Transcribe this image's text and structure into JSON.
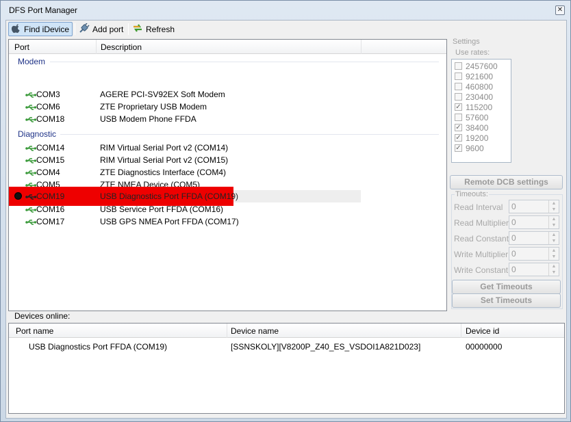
{
  "window": {
    "title": "DFS Port Manager",
    "close_glyph": "✕"
  },
  "toolbar": {
    "find": {
      "label": "Find iDevice",
      "icon": "apple-icon"
    },
    "add": {
      "label": "Add port",
      "icon": "plug-icon"
    },
    "refresh": {
      "label": "Refresh",
      "icon": "refresh-icon"
    }
  },
  "ports": {
    "columns": [
      "Port",
      "Description"
    ],
    "groups": [
      {
        "name": "Modem",
        "rows": [
          {
            "port": "COM3",
            "desc": "AGERE PCI-SV92EX Soft Modem"
          },
          {
            "port": "COM6",
            "desc": "ZTE Proprietary USB Modem"
          },
          {
            "port": "COM18",
            "desc": "USB Modem Phone FFDA"
          }
        ]
      },
      {
        "name": "Diagnostic",
        "rows": [
          {
            "port": "COM14",
            "desc": "RIM Virtual Serial Port v2 (COM14)"
          },
          {
            "port": "COM15",
            "desc": "RIM Virtual Serial Port v2 (COM15)"
          },
          {
            "port": "COM4",
            "desc": "ZTE Diagnostics Interface (COM4)"
          },
          {
            "port": "COM5",
            "desc": "ZTE NMEA Device (COM5)"
          },
          {
            "port": "COM19",
            "desc": "USB Diagnostics Port FFDA (COM19)",
            "selected": true
          },
          {
            "port": "COM16",
            "desc": "USB Service Port FFDA (COM16)"
          },
          {
            "port": "COM17",
            "desc": "USB GPS NMEA Port FFDA (COM17)"
          }
        ]
      }
    ]
  },
  "settings": {
    "legend": "Settings",
    "use_rates_label": "Use rates:",
    "rates": [
      {
        "value": "2457600",
        "checked": false
      },
      {
        "value": "921600",
        "checked": false
      },
      {
        "value": "460800",
        "checked": false
      },
      {
        "value": "230400",
        "checked": false
      },
      {
        "value": "115200",
        "checked": true
      },
      {
        "value": "57600",
        "checked": false
      },
      {
        "value": "38400",
        "checked": true
      },
      {
        "value": "19200",
        "checked": true
      },
      {
        "value": "9600",
        "checked": true
      }
    ],
    "remote_dcb_label": "Remote DCB settings",
    "timeouts_label": "Timeouts:",
    "timeouts": [
      {
        "label": "Read Interval",
        "value": "0"
      },
      {
        "label": "Read Multiplier:",
        "value": "0"
      },
      {
        "label": "Read Constant:",
        "value": "0"
      },
      {
        "label": "Write Multiplier:",
        "value": "0"
      },
      {
        "label": "Write Constant:",
        "value": "0"
      }
    ],
    "get_timeouts_label": "Get Timeouts",
    "set_timeouts_label": "Set Timeouts"
  },
  "devices": {
    "legend": "Devices online:",
    "columns": [
      "Port name",
      "Device name",
      "Device id"
    ],
    "rows": [
      {
        "port_name": "USB Diagnostics Port FFDA (COM19)",
        "device_name": "[SSNSKOLY][V8200P_Z40_ES_VSDOI1A821D023]",
        "device_id": "00000000"
      }
    ]
  },
  "colors": {
    "highlight": "#ee0000",
    "group_text": "#1e3287",
    "usb_icon": "#3a9a3a"
  }
}
